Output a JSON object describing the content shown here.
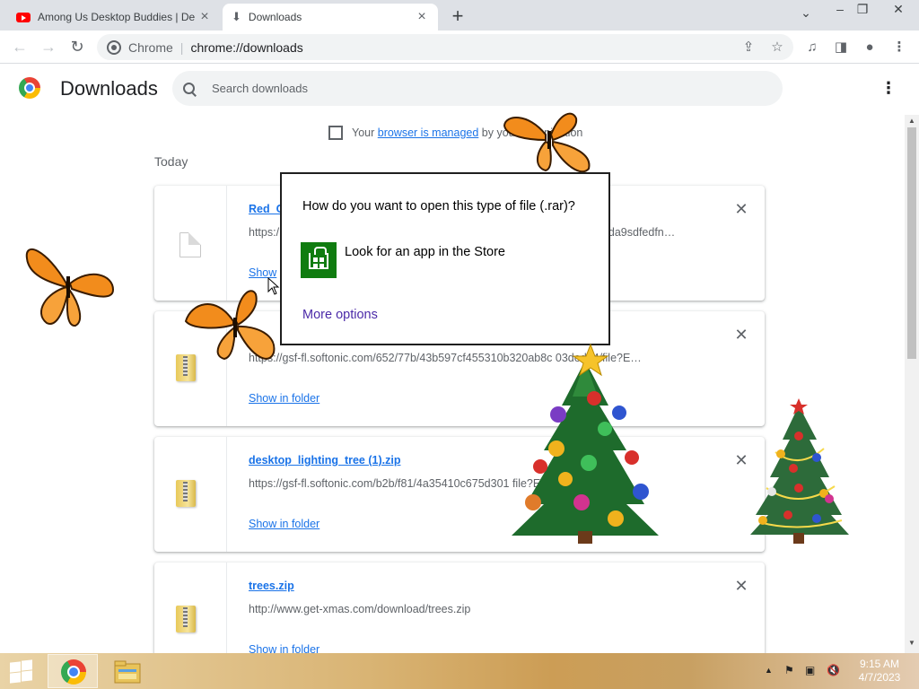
{
  "browser": {
    "tabs": [
      {
        "title": "Among Us Desktop Buddies | De",
        "icon": "youtube-icon",
        "active": false
      },
      {
        "title": "Downloads",
        "icon": "download-icon",
        "active": true
      }
    ],
    "new_tab_symbol": "+",
    "window_controls": {
      "tab_search": "⌄",
      "minimize": "–",
      "restore": "❐",
      "close": "✕"
    },
    "omnibox": {
      "site_label": "Chrome",
      "url": "chrome://downloads"
    }
  },
  "page": {
    "title": "Downloads",
    "search": {
      "placeholder": "Search downloads"
    },
    "managed_notice": {
      "prefix": "Your",
      "link": "browser is managed",
      "suffix": "by your organization"
    },
    "section_label": "Today",
    "downloads": [
      {
        "name": "Red_C",
        "url": "https://...88da9sdfedfn...",
        "url_left": "https:/",
        "url_right": "88da9sdfedfn…",
        "action": "Show in folder",
        "action_visible": "Show",
        "icon": "generic-file-icon"
      },
      {
        "name": "",
        "url": "https://gsf-fl.softonic.com/652/77b/43b597cf455310b320ab8c...03dedd4/file?E...",
        "url_display": "https://gsf-fl.softonic.com/652/77b/43b597cf455310b320ab8c     03dedd4/file?E…",
        "action": "Show in folder",
        "icon": "zip-icon"
      },
      {
        "name": "desktop_lighting_tree (1).zip",
        "url_display": "https://gsf-fl.softonic.com/b2b/f81/4a35410c675d301      file?E…",
        "action": "Show in folder",
        "icon": "zip-icon"
      },
      {
        "name": "trees.zip",
        "url_display": "http://www.get-xmas.com/download/trees.zip",
        "action": "Show in folder",
        "icon": "zip-icon"
      }
    ],
    "close_symbol": "✕"
  },
  "dialog": {
    "question": "How do you want to open this type of file (.rar)?",
    "store_option": "Look for an app in the Store",
    "more_options": "More options"
  },
  "taskbar": {
    "clock_time": "9:15 AM",
    "clock_date": "4/7/2023",
    "tray_arrow": "▲"
  },
  "colors": {
    "link": "#1a73e8",
    "store_green": "#107c10",
    "more_options": "#4b2aa8"
  }
}
